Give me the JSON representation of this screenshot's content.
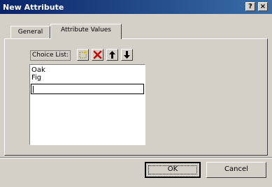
{
  "window": {
    "title": "New Attribute"
  },
  "titlebar_buttons": {
    "help": "?",
    "close": "×"
  },
  "tabs": [
    {
      "label": "General"
    },
    {
      "label": "Attribute Values"
    }
  ],
  "choice_list": {
    "label": "Choice List:",
    "tools": [
      {
        "icon": "new-item-icon",
        "color": "#808000"
      },
      {
        "icon": "delete-x-icon",
        "color": "#cc0000"
      },
      {
        "icon": "move-up-arrow-icon"
      },
      {
        "icon": "move-down-arrow-icon"
      }
    ],
    "items": [
      "Oak",
      "Fig"
    ],
    "edit_value": ""
  },
  "buttons": {
    "ok": "OK",
    "cancel": "Cancel"
  }
}
